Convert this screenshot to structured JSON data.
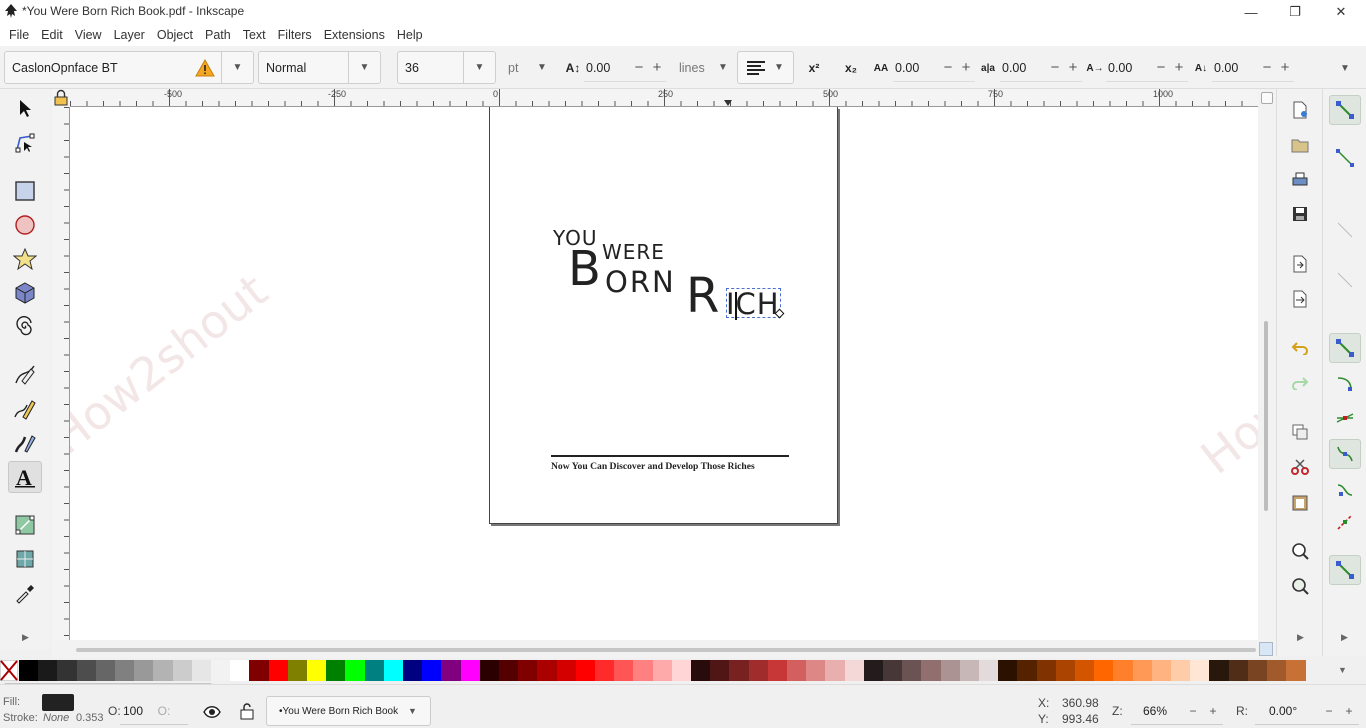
{
  "window": {
    "title": "*You Were Born Rich Book.pdf - Inkscape",
    "minimize": "—",
    "maximize": "❐",
    "close": "✕"
  },
  "menu": [
    "File",
    "Edit",
    "View",
    "Layer",
    "Object",
    "Path",
    "Text",
    "Filters",
    "Extensions",
    "Help"
  ],
  "toolbar": {
    "font_family": "CaslonOpnface BT",
    "font_style": "Normal",
    "font_size": "36",
    "unit": "pt",
    "line_spacing": "0.00",
    "spacing_mode": "lines",
    "letter_spacing": "0.00",
    "word_spacing": "0.00",
    "kerning_h": "0.00",
    "kerning_v": "0.00",
    "plus": "+",
    "minus": "−"
  },
  "ruler": {
    "h_labels": [
      "-500",
      "-250",
      "0",
      "250",
      "500",
      "750",
      "1000"
    ],
    "v_labels": [
      "-250",
      "0",
      "250",
      "500",
      "750",
      "1000",
      "1250"
    ]
  },
  "document": {
    "you": "YOU",
    "were": "WERE",
    "b": "B",
    "orn": "ORN",
    "r": "R",
    "ich": "ICH",
    "subtitle": "Now You Can Discover and Develop Those Riches"
  },
  "watermark": "How2shout",
  "palette_colors": [
    "#000000",
    "#1a1a1a",
    "#333333",
    "#4d4d4d",
    "#666666",
    "#808080",
    "#999999",
    "#b3b3b3",
    "#cccccc",
    "#e6e6e6",
    "#f2f2f2",
    "#ffffff",
    "#800000",
    "#ff0000",
    "#808000",
    "#ffff00",
    "#008000",
    "#00ff00",
    "#008080",
    "#00ffff",
    "#000080",
    "#0000ff",
    "#800080",
    "#ff00ff",
    "#2b0000",
    "#550000",
    "#800000",
    "#aa0000",
    "#d40000",
    "#ff0000",
    "#ff2a2a",
    "#ff5555",
    "#ff8080",
    "#ffaaaa",
    "#ffd5d5",
    "#280b0b",
    "#501616",
    "#782121",
    "#a02c2c",
    "#c83737",
    "#d35f5f",
    "#de8787",
    "#e9afaf",
    "#f4d7d7",
    "#241c1c",
    "#483737",
    "#6c5353",
    "#916f6f",
    "#ac9393",
    "#c8b7b7",
    "#e3dbdb",
    "#2b1100",
    "#552200",
    "#803300",
    "#aa4400",
    "#d45500",
    "#ff6600",
    "#ff7f2a",
    "#ff9955",
    "#ffb380",
    "#ffccaa",
    "#ffe6d5",
    "#28170b",
    "#502d16",
    "#784421",
    "#a05a2c",
    "#c87137"
  ],
  "status": {
    "fill_label": "Fill:",
    "stroke_label": "Stroke:",
    "stroke_value": "None",
    "stroke_width": "0.353",
    "opacity_label": "O:",
    "opacity": "100",
    "layer": "•You Were Born Rich Book",
    "x_label": "X:",
    "x": "360.98",
    "y_label": "Y:",
    "y": "993.46",
    "zoom_label": "Z:",
    "zoom": "66%",
    "rotate_label": "R:",
    "rotation": "0.00°"
  }
}
